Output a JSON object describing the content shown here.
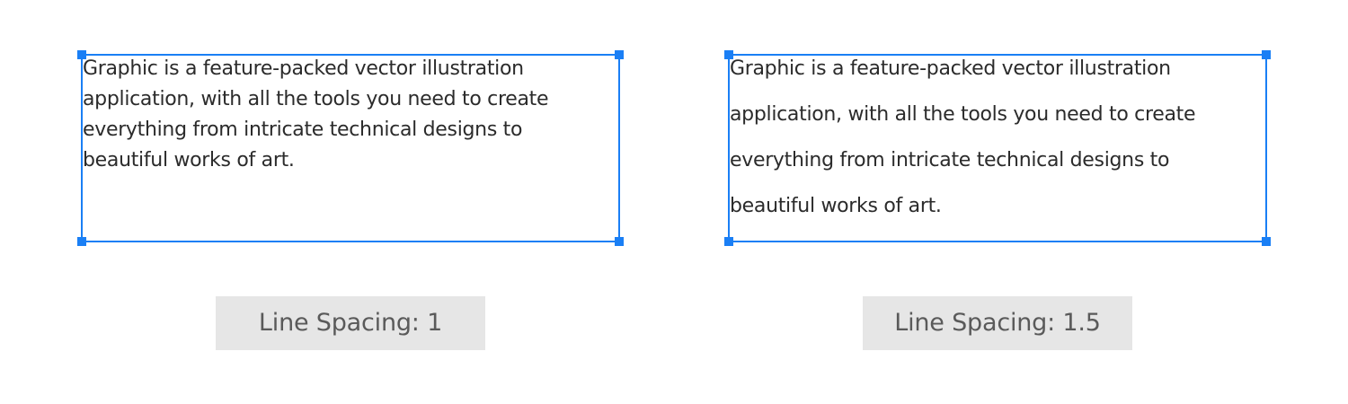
{
  "accent_color": "#1a7ff5",
  "sample_text_lines": [
    "Graphic is a feature-packed vector illustration",
    "application, with all the tools you need to create",
    "everything from intricate technical designs to",
    "beautiful works of art."
  ],
  "examples": [
    {
      "caption": "Line Spacing: 1",
      "line_spacing": 1
    },
    {
      "caption": "Line Spacing: 1.5",
      "line_spacing": 1.5
    }
  ]
}
